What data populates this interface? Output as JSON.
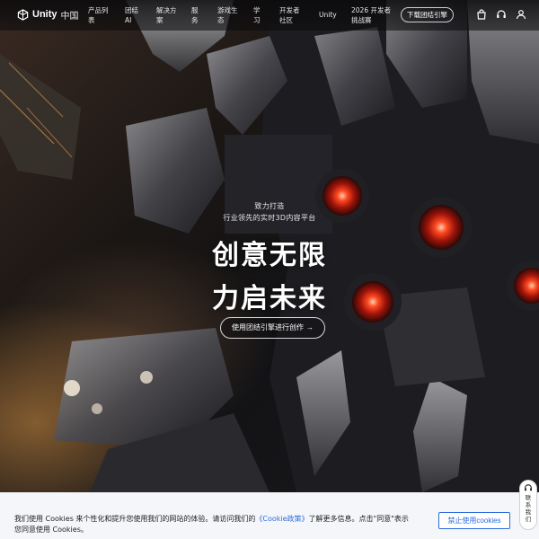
{
  "nav": {
    "logo_text": "Unity",
    "logo_region": "中国",
    "items": [
      {
        "label": "产品列表"
      },
      {
        "label": "团结 AI"
      },
      {
        "label": "解决方案"
      },
      {
        "label": "服务"
      },
      {
        "label": "游戏生态"
      },
      {
        "label": "学习"
      },
      {
        "label": "开发者社区"
      },
      {
        "label": "Unity"
      },
      {
        "label": "2026 开发者挑战赛"
      }
    ],
    "download_button": "下载团结引擎",
    "icons": [
      "shopping-bag-icon",
      "headset-icon",
      "user-icon"
    ]
  },
  "hero": {
    "tagline_1": "致力打造",
    "tagline_2": "行业领先的实时3D内容平台",
    "headline_1": "创意无限",
    "headline_2": "力启未来",
    "cta_label": "使用团结引擎进行创作",
    "cta_arrow": "→"
  },
  "contact": {
    "label": "联系我们",
    "icon": "headset-icon"
  },
  "cookie": {
    "text_before": "我们使用 Cookies 来个性化和提升您使用我们的网站的体验。请访问我们的",
    "link": "《Cookie政策》",
    "text_after": "了解更多信息。点击\"同意\"表示您同意使用 Cookies。",
    "reject_button": "禁止使用cookies"
  },
  "colors": {
    "link_blue": "#2d6cdf",
    "banner_bg": "#f4f6f9",
    "eye_red": "#ff3a1e"
  }
}
